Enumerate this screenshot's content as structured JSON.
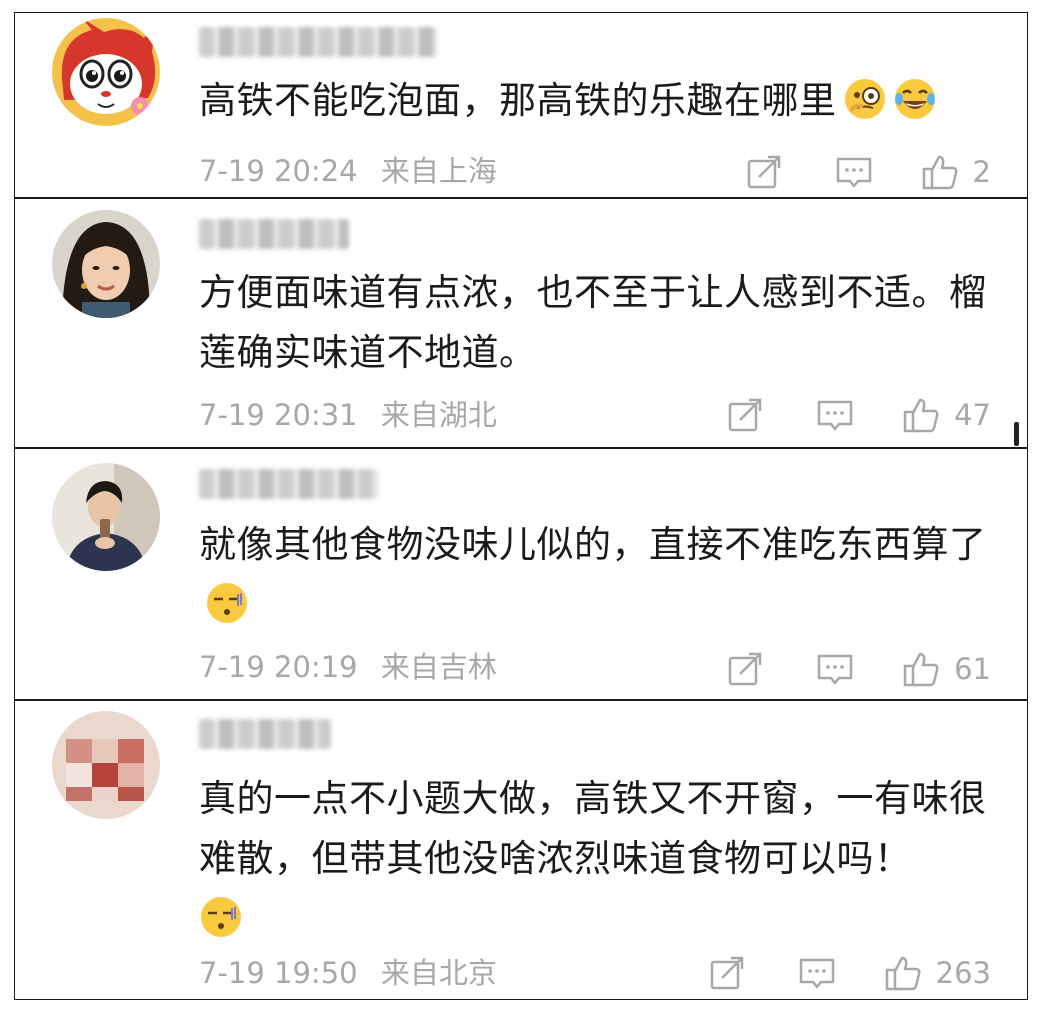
{
  "comments": [
    {
      "content": "高铁不能吃泡面，那高铁的乐趣在哪里",
      "emojis": [
        "thinking-monocle-emoji",
        "laughing-tears-emoji"
      ],
      "time": "7-19 20:24",
      "location": "来自上海",
      "likes": "2",
      "avatar": "red-panda-cartoon-avatar"
    },
    {
      "content": "方便面味道有点浓，也不至于让人感到不适。榴莲确实味道不地道。",
      "emojis": [],
      "time": "7-19 20:31",
      "location": "来自湖北",
      "likes": "47",
      "avatar": "woman-portrait-avatar"
    },
    {
      "content": "就像其他食物没味儿似的，直接不准吃东西算了",
      "emojis": [
        "speechless-emoji"
      ],
      "time": "7-19 20:19",
      "location": "来自吉林",
      "likes": "61",
      "avatar": "man-drinking-avatar"
    },
    {
      "content": "真的一点不小题大做，高铁又不开窗，一有味很难散，但带其他没啥浓烈味道食物可以吗！",
      "emojis": [
        "speechless-emoji"
      ],
      "time": "7-19 19:50",
      "location": "来自北京",
      "likes": "263",
      "avatar": "blurred-avatar"
    }
  ],
  "colors": {
    "text": "#1b1b1b",
    "meta": "#a8a8a8",
    "border": "#1a1a1a"
  },
  "icons": [
    "repost-icon",
    "comment-icon",
    "like-icon"
  ]
}
